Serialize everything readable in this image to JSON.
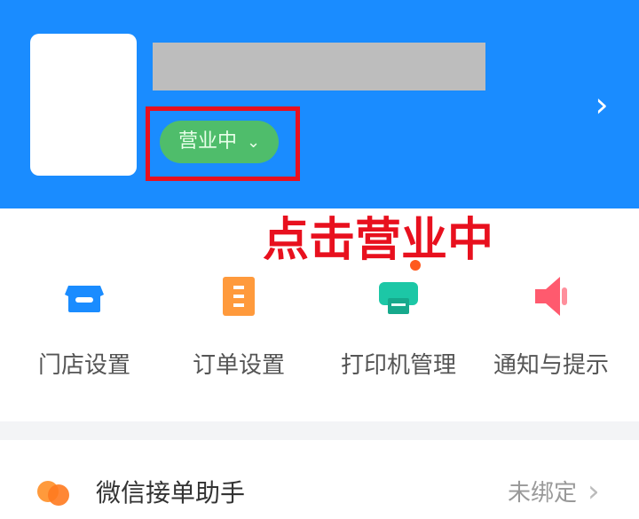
{
  "header": {
    "status_label": "营业中",
    "status_chevron": "⌄",
    "chevron": "›"
  },
  "annotation": {
    "text": "点击营业中",
    "color": "#e8101e"
  },
  "tools": [
    {
      "label": "门店设置",
      "icon": "store-icon",
      "color": "#1a8cff"
    },
    {
      "label": "订单设置",
      "icon": "order-icon",
      "color": "#ff9a3c"
    },
    {
      "label": "打印机管理",
      "icon": "printer-icon",
      "color": "#1cc7a6"
    },
    {
      "label": "通知与提示",
      "icon": "speaker-icon",
      "color": "#ff5a6e"
    }
  ],
  "assistant": {
    "label": "微信接单助手",
    "status": "未绑定",
    "chevron": "›",
    "icon": "wechat-assistant-icon"
  },
  "colors": {
    "brand": "#1a8cff",
    "open_status": "#4fbd6b",
    "highlight": "#e8101e"
  }
}
